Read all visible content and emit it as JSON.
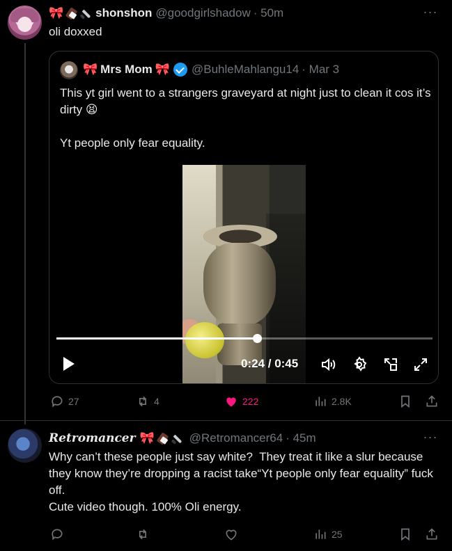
{
  "post1": {
    "display_name": "shonshon",
    "handle": "@goodgirlshadow",
    "time": "· 50m",
    "text": "oli doxxed",
    "quote": {
      "display_name": "Mrs Mom",
      "handle": "@BuhleMahlangu14",
      "time": "· Mar 3",
      "text": "This yt girl went to a strangers graveyard at night just to clean it cos it’s dirty 😫\n\nYt people only fear equality.",
      "video": {
        "current_time": "0:24",
        "duration": "0:45",
        "time_label": "0:24 / 0:45",
        "progress_fraction": 0.533
      }
    },
    "actions": {
      "replies": "27",
      "reposts": "4",
      "likes": "222",
      "views": "2.8K"
    }
  },
  "post2": {
    "display_name": "Retromancer",
    "handle": "@Retromancer64",
    "time": "· 45m",
    "text": "Why can’t these people just say white?  They treat it like a slur because they know they’re dropping a racist take“Yt people only fear equality” fuck off.\nCute video though. 100% Oli energy.",
    "actions": {
      "replies": "",
      "reposts": "",
      "likes": "",
      "views": "25"
    }
  },
  "colors": {
    "background": "#000000",
    "text": "#e7e9ea",
    "muted": "#71767b",
    "like_active": "#f91880",
    "verified": "#1d9bf0",
    "ribbon": "#e0245e"
  },
  "icons": [
    "ribbon-emoji",
    "chocolate-emoji",
    "knife-emoji",
    "verified-badge-icon",
    "more-icon",
    "play-icon",
    "volume-icon",
    "settings-icon",
    "pop-out-icon",
    "fullscreen-icon",
    "reply-icon",
    "repost-icon",
    "like-icon",
    "views-icon",
    "bookmark-icon",
    "share-icon"
  ]
}
